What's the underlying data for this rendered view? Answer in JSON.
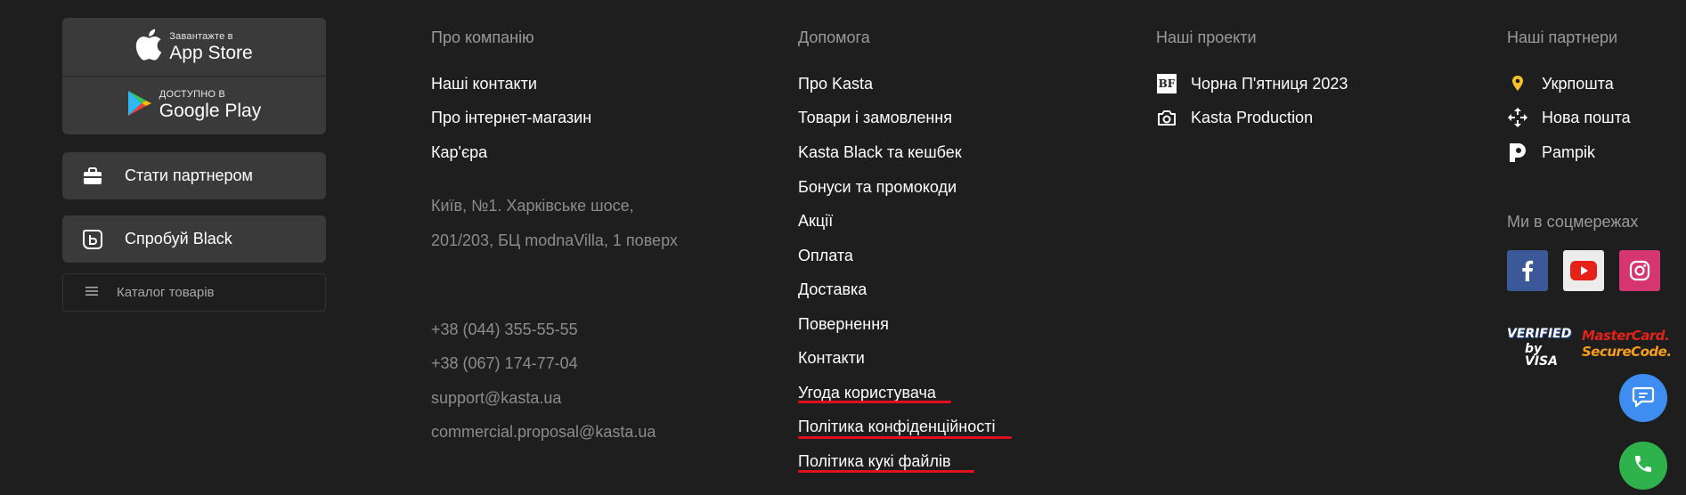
{
  "stores": {
    "appstore": {
      "small": "Завантажте в",
      "big": "App Store"
    },
    "googleplay": {
      "small": "ДОСТУПНО В",
      "big": "Google Play"
    }
  },
  "side_buttons": {
    "partner": "Стати партнером",
    "black": "Спробуй Black",
    "catalog": "Каталог товарів"
  },
  "about": {
    "heading": "Про компанію",
    "links": [
      "Наші контакти",
      "Про інтернет-магазин",
      "Кар'єра"
    ],
    "address": "Київ, №1. Харківське шосе, 201/203, БЦ modnaVilla, 1 поверх",
    "contacts": [
      "+38 (044) 355-55-55",
      "+38 (067) 174-77-04",
      "support@kasta.ua",
      "commercial.proposal@kasta.ua"
    ]
  },
  "help": {
    "heading": "Допомога",
    "links": [
      "Про Kasta",
      "Товари і замовлення",
      "Kasta Black та кешбек",
      "Бонуси та промокоди",
      "Акції",
      "Оплата",
      "Доставка",
      "Повернення",
      "Контакти",
      "Угода користувача",
      "Політика конфіденційності",
      "Політика кукі файлів"
    ]
  },
  "projects": {
    "heading": "Наші проекти",
    "items": [
      {
        "label": "Чорна П'ятниця 2023",
        "icon": "bf-logo-icon",
        "badge": "BF"
      },
      {
        "label": "Kasta Production",
        "icon": "camera-icon"
      }
    ]
  },
  "partners": {
    "heading": "Наші партнери",
    "items": [
      {
        "label": "Укрпошта",
        "icon": "ukrposhta-icon"
      },
      {
        "label": "Нова пошта",
        "icon": "nova-poshta-icon"
      },
      {
        "label": "Pampik",
        "icon": "pampik-icon"
      }
    ]
  },
  "social": {
    "heading": "Ми в соцмережах",
    "items": [
      "facebook-icon",
      "youtube-icon",
      "instagram-icon"
    ]
  },
  "payment_badges": {
    "visa": {
      "line1": "VERIFIED",
      "line2": "by VISA"
    },
    "mastercard": {
      "line1": "MasterCard.",
      "line2": "SecureCode."
    }
  },
  "colors": {
    "background": "#1e1e1e",
    "button_bg": "#3a3a3a",
    "underline": "#e0101c",
    "chat": "#3d8ef0",
    "phone": "#2fb24c"
  }
}
